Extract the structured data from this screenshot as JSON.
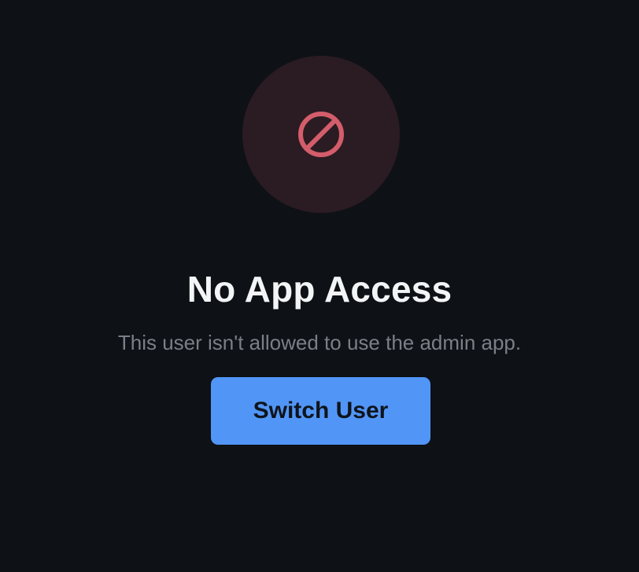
{
  "icon": {
    "name": "prohibited-icon",
    "color": "#d45d6b",
    "background": "#2a1c22"
  },
  "title": "No App Access",
  "message": "This user isn't allowed to use the admin app.",
  "switch_user_button": {
    "label": "Switch User",
    "color": "#5196f7"
  },
  "colors": {
    "page_background": "#0e1116",
    "title_text": "#f3f4f6",
    "message_text": "#7a7f88"
  }
}
